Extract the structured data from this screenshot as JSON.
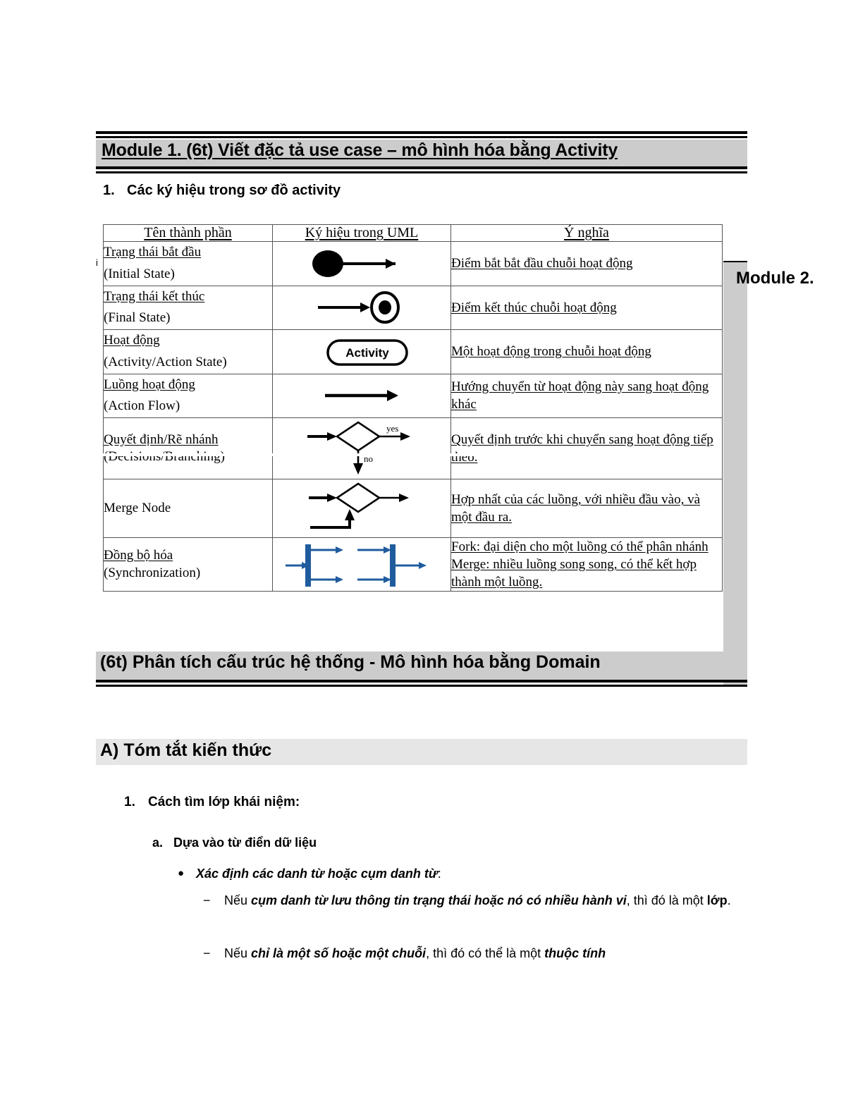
{
  "module1": {
    "title": "Module 1. (6t) Viết đặc tả use case – mô hình hóa bằng Activity",
    "section1_number": "1.",
    "section1_title": "Các ký hiệu trong sơ đồ activity"
  },
  "module2": {
    "title": "Module 2."
  },
  "stray_artifact": "i",
  "symbol_table": {
    "headers": [
      "Tên thành phần",
      "Ký hiệu trong UML",
      "Ý nghĩa"
    ],
    "rows": [
      {
        "name_vi": "Trạng thái bắt đầu",
        "name_en": "(Initial State)",
        "symbol": "initial-state-symbol",
        "meaning": "Điểm bắt bắt đầu chuỗi hoạt động"
      },
      {
        "name_vi": "Trạng thái kết thúc",
        "name_en": "(Final State)",
        "symbol": "final-state-symbol",
        "meaning": "Điểm kết thúc chuỗi hoạt động"
      },
      {
        "name_vi": "Hoạt động",
        "name_en": "(Activity/Action State)",
        "symbol": "activity-state-symbol",
        "symbol_label": "Activity",
        "meaning": "Một hoạt động trong chuỗi hoạt động"
      },
      {
        "name_vi": "Luồng hoạt động",
        "name_en": "(Action Flow)",
        "symbol": "action-flow-symbol",
        "meaning": "Hướng chuyển từ hoạt động này sang hoạt động khác"
      },
      {
        "name_vi": "Quyết định/Rẽ nhánh",
        "name_en": "(Decisions/Branching)",
        "symbol": "decision-node-symbol",
        "symbol_label_yes": "yes",
        "symbol_label_no": "no",
        "meaning": "Quyết định trước khi chuyển sang hoạt động tiếp theo."
      },
      {
        "name_vi": "Merge Node",
        "name_en": "",
        "symbol": "merge-node-symbol",
        "meaning": "Hợp nhất của các luồng, với nhiều đầu vào, và một đầu ra."
      },
      {
        "name_vi": "Đồng bộ hóa",
        "name_en": "(Synchronization)",
        "symbol": "synchronization-symbol",
        "meaning_line1": "Fork: đại diện cho một luồng có thể phân nhánh",
        "meaning_line2": "Merge: nhiều luồng song song, có thể kết hợp thành một luồng."
      }
    ]
  },
  "module1b": {
    "title": "(6t) Phân tích cấu trúc hệ thống - Mô hình hóa bằng Domain"
  },
  "sectionA": {
    "title": "A) Tóm tắt kiến thức",
    "item1_marker": "1.",
    "item1_text": "Cách tìm lớp khái niệm:",
    "item_a_marker": "a.",
    "item_a_text": "Dựa vào từ điển dữ liệu",
    "bullet1_prefix": "Xác định các danh từ hoặc cụm danh từ",
    "bullet1_suffix": ":",
    "dash_marker": "−",
    "dash1": {
      "p1": "Nếu ",
      "p2": "cụm danh từ lưu thông tin trạng thái hoặc nó có nhiều hành vi",
      "p3": ", thì đó là một ",
      "p4": "lớp",
      "p5": "."
    },
    "dash2": {
      "p1": " Nếu ",
      "p2": "chỉ là một số hoặc một chuỗi",
      "p3": ", thì đó có thể là một ",
      "p4": "thuộc tính"
    }
  },
  "colors": {
    "banner_gray": "#cccccc",
    "section_gray": "#e6e6e6",
    "sync_blue": "#1f5c9e",
    "ink": "#000000"
  }
}
